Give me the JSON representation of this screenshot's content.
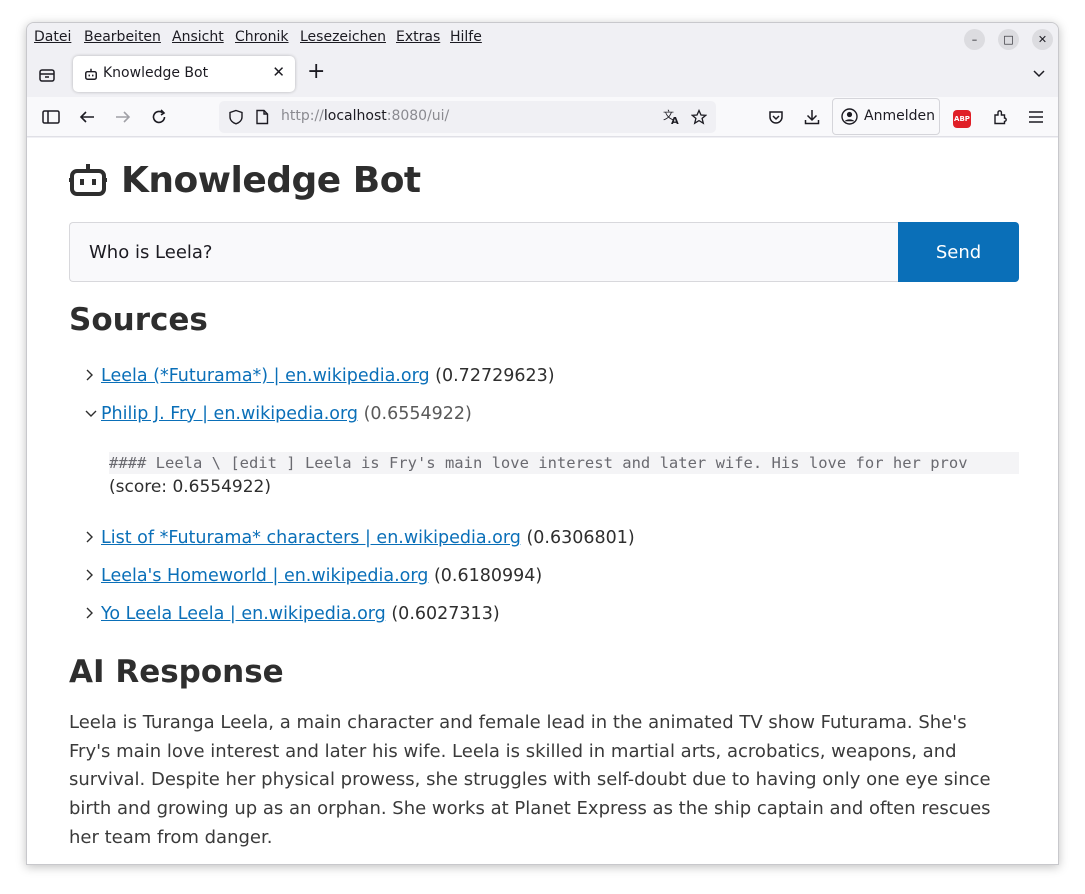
{
  "menubar": {
    "items": [
      {
        "label": "Datei"
      },
      {
        "label": "Bearbeiten"
      },
      {
        "label": "Ansicht"
      },
      {
        "label": "Chronik"
      },
      {
        "label": "Lesezeichen"
      },
      {
        "label": "Extras"
      },
      {
        "label": "Hilfe"
      }
    ],
    "minimize": "–",
    "maximize": "□",
    "close": "✕"
  },
  "tab": {
    "title": "Knowledge Bot",
    "close": "✕",
    "new_tab": "+"
  },
  "navbar": {
    "url_prefix": "http://",
    "url_host": "localhost",
    "url_rest": ":8080/ui/",
    "signin_label": "Anmelden",
    "abp_label": "ABP"
  },
  "page": {
    "title": "Knowledge Bot",
    "query_value": "Who is Leela?",
    "send_label": "Send",
    "sources_heading": "Sources",
    "sources": [
      {
        "link": "Leela (*Futurama*) | en.wikipedia.org",
        "score": "(0.72729623)",
        "expanded": false
      },
      {
        "link": "Philip J. Fry | en.wikipedia.org",
        "score": "(0.6554922)",
        "expanded": true
      },
      {
        "link": "List of *Futurama* characters | en.wikipedia.org",
        "score": "(0.6306801)",
        "expanded": false
      },
      {
        "link": "Leela's Homeworld | en.wikipedia.org",
        "score": "(0.6180994)",
        "expanded": false
      },
      {
        "link": "Yo Leela Leela | en.wikipedia.org",
        "score": "(0.6027313)",
        "expanded": false
      }
    ],
    "expanded_snippet": "#### Leela \\ [edit ] Leela is Fry's main love interest and later wife. His love for her prov",
    "expanded_score": "(score: 0.6554922)",
    "response_heading": "AI Response",
    "response_text": "Leela is Turanga Leela, a main character and female lead in the animated TV show Futurama. She's Fry's main love interest and later his wife. Leela is skilled in martial arts, acrobatics, weapons, and survival. Despite her physical prowess, she struggles with self-doubt due to having only one eye since birth and growing up as an orphan. She works at Planet Express as the ship captain and often rescues her team from danger."
  },
  "colors": {
    "accent": "#0a6fb8",
    "abp": "#e01f27"
  }
}
